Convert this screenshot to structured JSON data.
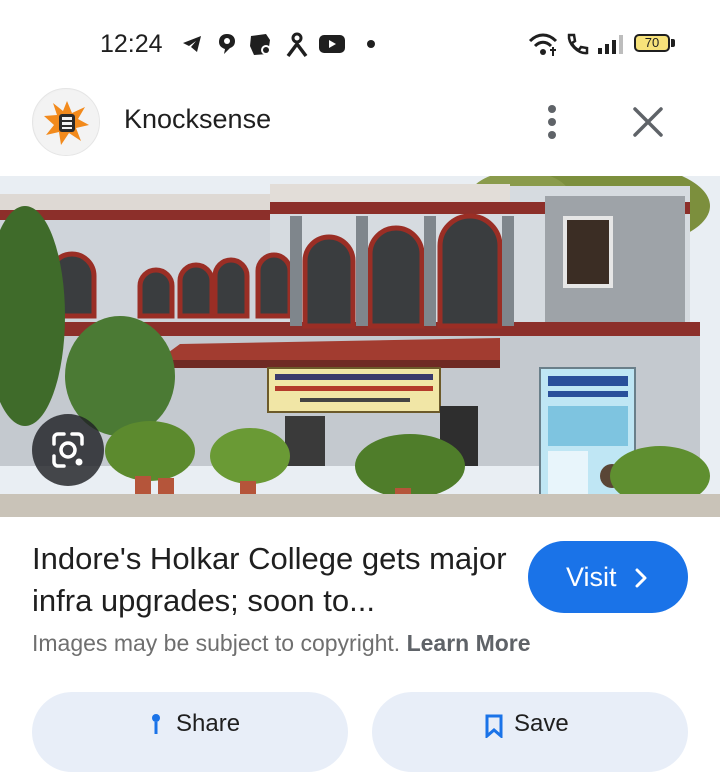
{
  "status_bar": {
    "time": "12:24",
    "notification_icons": [
      "telegram-icon",
      "app-icon",
      "gear-badge-icon",
      "person-icon",
      "youtube-icon",
      "dot-icon"
    ],
    "system_icons": [
      "wifi-icon",
      "call-icon",
      "signal-icon"
    ],
    "battery": "70"
  },
  "header": {
    "source_name": "Knocksense",
    "logo_icon": "knocksense-logo-icon",
    "more_icon": "more-vert-icon",
    "close_icon": "close-icon"
  },
  "image": {
    "banner_text": "शासकीय होलकर (आदर्श, स्वशासी) विज्ञान महाविद्यालय, इन्दौर",
    "lens_icon": "google-lens-icon"
  },
  "result": {
    "title": "Indore's Holkar College gets major infra upgrades; soon to...",
    "visit_label": "Visit",
    "copyright_text": "Images may be subject to copyright.",
    "learn_more": "Learn More"
  },
  "actions": {
    "share_label": "Share",
    "save_label": "Save",
    "share_icon": "share-icon",
    "save_icon": "bookmark-icon"
  },
  "colors": {
    "accent": "#1a73e8",
    "action_bg": "#e8eef8",
    "battery_fill": "#f7e27a"
  }
}
